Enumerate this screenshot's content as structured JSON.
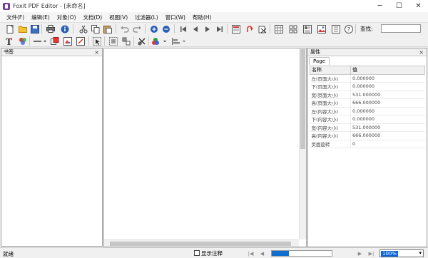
{
  "window": {
    "title": "Foxit PDF Editor - [未命名]",
    "minimize": "─",
    "maximize": "☐",
    "close": "✕"
  },
  "menu": [
    "文件(F)",
    "编辑(E)",
    "对象(O)",
    "文档(D)",
    "视图(V)",
    "过滤器(L)",
    "窗口(W)",
    "帮助(H)"
  ],
  "search": {
    "label": "查找:",
    "value": ""
  },
  "bookmark_pane": {
    "title": "书签",
    "close": "×"
  },
  "properties_pane": {
    "title": "属性",
    "close": "×",
    "tab": "Page",
    "col_name": "名称",
    "col_value": "值",
    "rows": [
      {
        "name": "左(页面大小)",
        "value": "0.000000"
      },
      {
        "name": "下(页面大小)",
        "value": "0.000000"
      },
      {
        "name": "宽(页面大小)",
        "value": "531.000000"
      },
      {
        "name": "高(页面大小)",
        "value": "666.000000"
      },
      {
        "name": "左(内容大小)",
        "value": "0.000000"
      },
      {
        "name": "下(内容大小)",
        "value": "0.000000"
      },
      {
        "name": "宽(内容大小)",
        "value": "531.000000"
      },
      {
        "name": "高(内容大小)",
        "value": "666.000000"
      },
      {
        "name": "页面旋转",
        "value": "0"
      }
    ]
  },
  "status": {
    "text": "就绪",
    "show_annotations": "显示注释",
    "zoom": "100%",
    "nav_first": "|◀",
    "nav_prev": "◀",
    "nav_next": "▶",
    "nav_last": "▶|",
    "zoom_arrow": "▾"
  },
  "toolbar_icons_row1": [
    "new-doc-icon",
    "open-folder-icon",
    "save-icon",
    "print-icon",
    "info-icon",
    "cut-icon",
    "copy-icon",
    "paste-icon",
    "undo-icon",
    "redo-icon",
    "zoom-in-icon",
    "zoom-out-icon",
    "first-page-icon",
    "prev-page-icon",
    "next-page-icon",
    "last-page-icon",
    "page-view-icon",
    "rotate-page-icon",
    "crop-icon",
    "grid-icon",
    "align-icon",
    "layout-icon",
    "image-icon",
    "properties-icon",
    "help-icon"
  ],
  "toolbar_icons_row2": [
    "text-tool-icon",
    "color-icon",
    "line-tool-icon",
    "shape-icon",
    "image-insert-icon",
    "edit-icon",
    "select-icon",
    "group-icon",
    "ungroup-icon",
    "delete-icon",
    "fill-color-icon",
    "align-tool-icon"
  ]
}
